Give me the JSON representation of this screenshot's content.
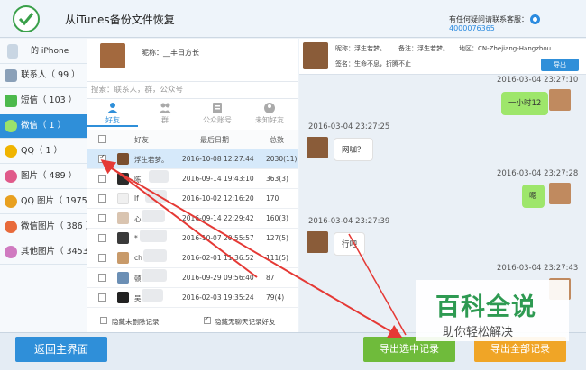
{
  "app": {
    "title": "从iTunes备份文件恢复",
    "help_prefix": "有任何疑问请联系客服：",
    "help_qq": "4000076365"
  },
  "sidebar": {
    "device": "的 iPhone",
    "items": [
      {
        "label": "联系人（ 99 ）",
        "icon": "contacts-icon",
        "color": "#8aa0b8"
      },
      {
        "label": "短信（ 103 ）",
        "icon": "sms-icon",
        "color": "#4cb94c"
      },
      {
        "label": "微信（ 1 ）",
        "icon": "wechat-icon",
        "color": "#4cb94c"
      },
      {
        "label": "QQ（ 1 ）",
        "icon": "qq-icon",
        "color": "#f0b400"
      },
      {
        "label": "图片（ 489 ）",
        "icon": "photos-icon",
        "color": "#e05a8a"
      },
      {
        "label": "QQ 图片（ 1975 ）",
        "icon": "qq-photos-icon",
        "color": "#e8a020"
      },
      {
        "label": "微信图片（ 386 ）",
        "icon": "wechat-photos-icon",
        "color": "#e86a3a"
      },
      {
        "label": "其他图片（ 3453 ）",
        "icon": "other-photos-icon",
        "color": "#d07ac0"
      }
    ]
  },
  "contact": {
    "nickname": "昵称：__丰日方长"
  },
  "search": {
    "placeholder": "搜索：联系人，群，公众号"
  },
  "tabs": [
    "好友",
    "群",
    "公众账号",
    "未知好友"
  ],
  "table": {
    "headers": [
      "好友",
      "最后日期",
      "总数"
    ],
    "rows": [
      {
        "name": "浮生若梦。",
        "date": "2016-10-08 12:27:44",
        "count": "2030(11)",
        "checked": true
      },
      {
        "name": "陈",
        "date": "2016-09-14 19:43:10",
        "count": "363(3)",
        "checked": false
      },
      {
        "name": "lf",
        "date": "2016-10-02 12:16:20",
        "count": "170",
        "checked": false
      },
      {
        "name": "心",
        "date": "2016-09-14 22:29:42",
        "count": "160(3)",
        "checked": false
      },
      {
        "name": "*",
        "date": "2016-10-07 20:55:57",
        "count": "127(5)",
        "checked": false
      },
      {
        "name": "ch",
        "date": "2016-02-01 11:36:52",
        "count": "111(5)",
        "checked": false
      },
      {
        "name": "顿",
        "date": "2016-09-29 09:56:40",
        "count": "87",
        "checked": false
      },
      {
        "name": "吴",
        "date": "2016-02-03 19:35:24",
        "count": "79(4)",
        "checked": false
      }
    ]
  },
  "options": {
    "hide_deleted": "隐藏未删除记录",
    "hide_no_records": "隐藏无聊天记录好友"
  },
  "chat": {
    "nick": "昵称：浮生若梦。",
    "note": "备注：浮生若梦。",
    "region": "地区：CN-Zhejiang-Hangzhou",
    "signature": "签名：生命不息，折腾不止",
    "export": "导出",
    "messages": [
      {
        "time": "2016-03-04 23:27:10",
        "text": "一小时12",
        "side": "me"
      },
      {
        "time": "2016-03-04 23:27:25",
        "text": "网咖？",
        "side": "them"
      },
      {
        "time": "2016-03-04 23:27:28",
        "text": "嗯",
        "side": "me"
      },
      {
        "time": "2016-03-04 23:27:39",
        "text": "行吧",
        "side": "them"
      },
      {
        "time": "2016-03-04 23:27:43",
        "text": "",
        "side": "me"
      }
    ]
  },
  "footer": {
    "back": "返回主界面",
    "export_selected": "导出选中记录",
    "export_all": "导出全部记录"
  },
  "watermark": {
    "main": "百科全说",
    "sub": "助你轻松解决"
  },
  "colors": {
    "accent": "#2f8fd9",
    "green": "#6fbb3b",
    "orange": "#f0a526",
    "arrow": "#e53935"
  }
}
